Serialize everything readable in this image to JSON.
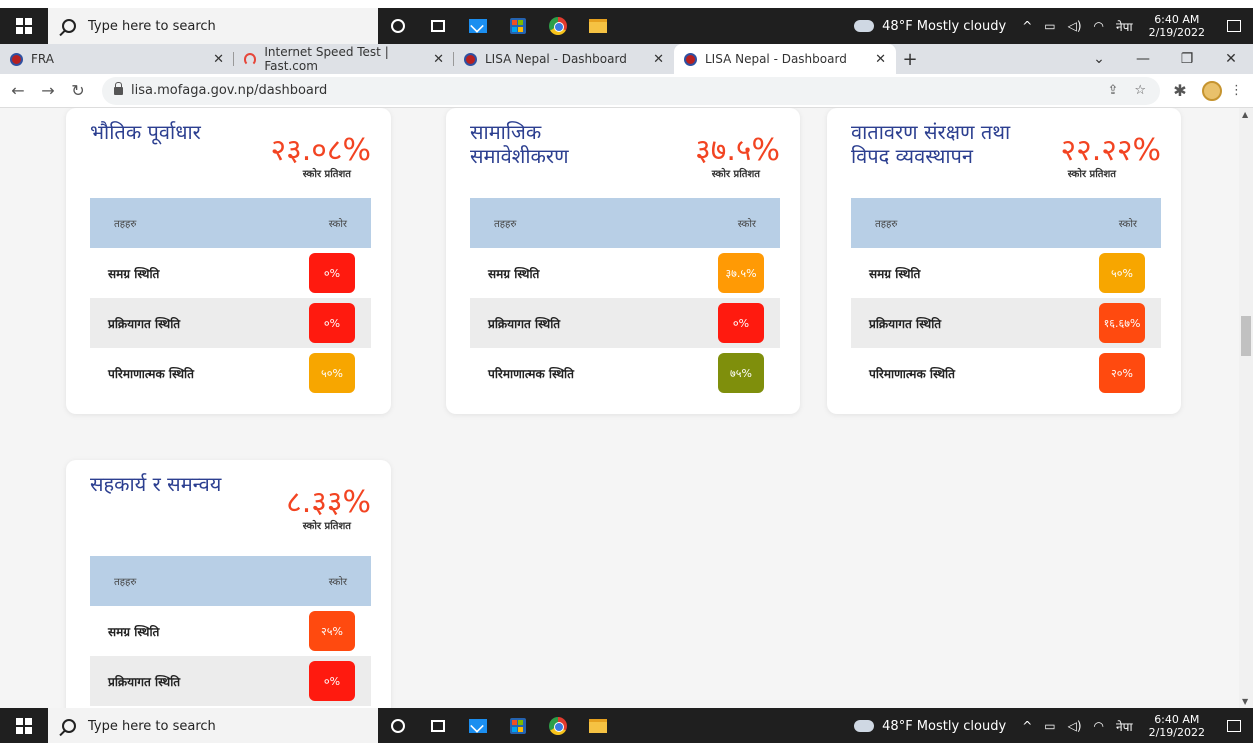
{
  "taskbar": {
    "search_placeholder": "Type here to search",
    "weather": "48°F  Mostly cloudy",
    "lang": "नेपा",
    "time": "6:40 AM",
    "date": "2/19/2022"
  },
  "browser": {
    "tabs": [
      {
        "label": "FRA",
        "active": false
      },
      {
        "label": "Internet Speed Test | Fast.com",
        "active": false
      },
      {
        "label": "LISA Nepal - Dashboard",
        "active": false
      },
      {
        "label": "LISA Nepal - Dashboard",
        "active": true
      }
    ],
    "url": "lisa.mofaga.gov.np/dashboard"
  },
  "colors": {
    "red": "#ff1a0f",
    "orange": "#ff9a05",
    "amber": "#f7a600",
    "deep_orange": "#ff4a0f",
    "olive": "#7f8f0c"
  },
  "common": {
    "score_label": "स्कोर प्रतिशत",
    "col_indicator": "तहहरु",
    "col_score": "स्कोर"
  },
  "cards": [
    {
      "title": "भौतिक पूर्वाधार",
      "percent": "२३.०८%",
      "rows": [
        {
          "label": "समग्र स्थिति",
          "value": "०%"
        },
        {
          "label": "प्रक्रियागत स्थिति",
          "value": "०%"
        },
        {
          "label": "परिमाणात्मक स्थिति",
          "value": "५०%"
        }
      ]
    },
    {
      "title": "सामाजिक समावेशीकरण",
      "percent": "३७.५%",
      "rows": [
        {
          "label": "समग्र स्थिति",
          "value": "३७.५%"
        },
        {
          "label": "प्रक्रियागत स्थिति",
          "value": "०%"
        },
        {
          "label": "परिमाणात्मक स्थिति",
          "value": "७५%"
        }
      ]
    },
    {
      "title": "वातावरण संरक्षण तथा विपद व्यवस्थापन",
      "percent": "२२.२२%",
      "rows": [
        {
          "label": "समग्र स्थिति",
          "value": "५०%"
        },
        {
          "label": "प्रक्रियागत स्थिति",
          "value": "१६.६७%"
        },
        {
          "label": "परिमाणात्मक स्थिति",
          "value": "२०%"
        }
      ]
    },
    {
      "title": "सहकार्य र समन्वय",
      "percent": "८.३३%",
      "rows": [
        {
          "label": "समग्र स्थिति",
          "value": "२५%"
        },
        {
          "label": "प्रक्रियागत स्थिति",
          "value": "०%"
        }
      ]
    }
  ]
}
